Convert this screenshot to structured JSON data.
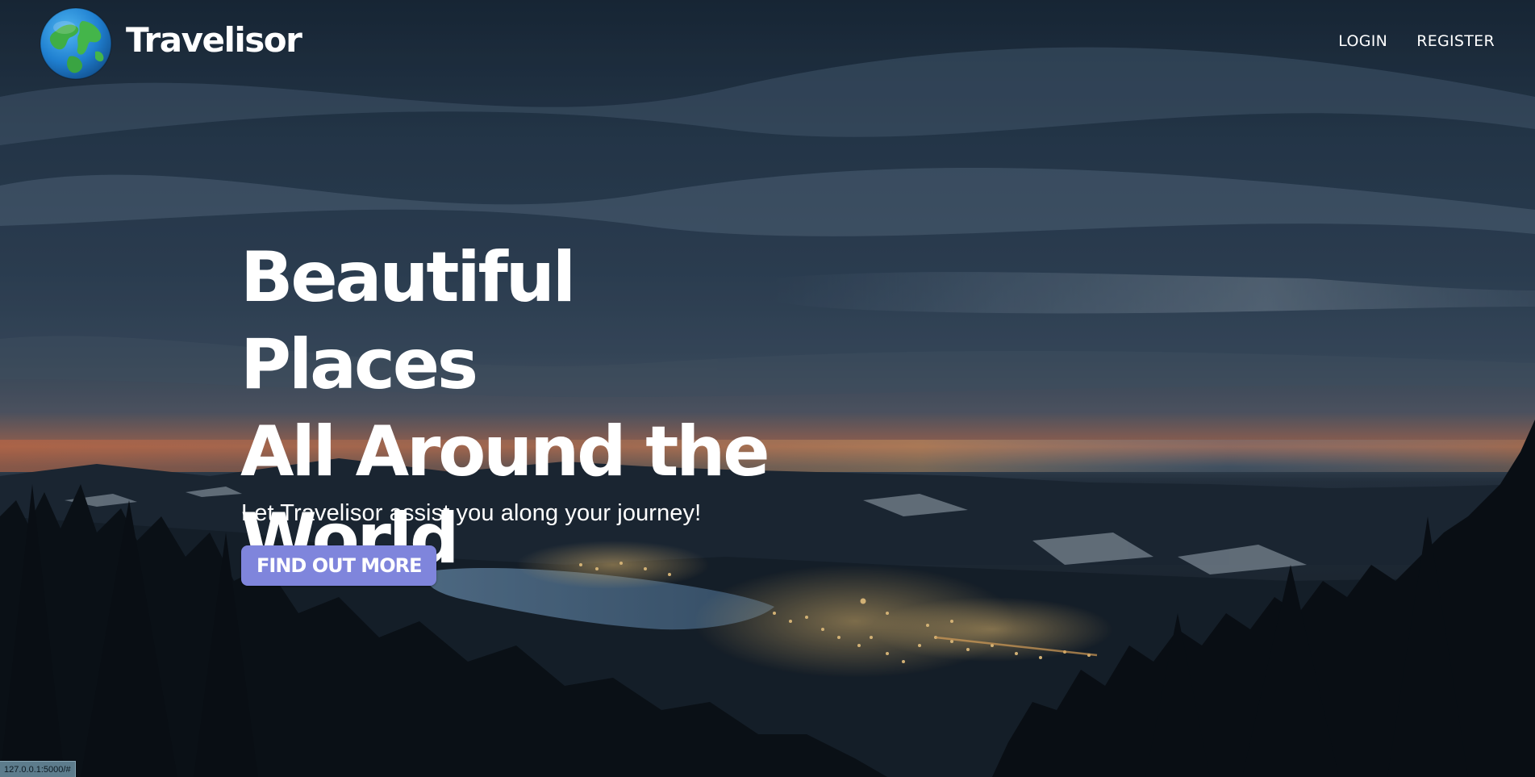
{
  "brand": {
    "name": "Travelisor",
    "logo_icon": "globe-icon"
  },
  "nav": {
    "links": [
      {
        "label": "LOGIN"
      },
      {
        "label": "REGISTER"
      }
    ]
  },
  "hero": {
    "headline_lines": [
      "Beautiful Places",
      "All Around the",
      "World"
    ],
    "tagline": "Let Travelisor assist you along your journey!",
    "cta_label": "FIND OUT MORE",
    "background": "night-landscape-lake-town-mountains"
  },
  "status_bar": {
    "url": "127.0.0.1:5000/#"
  },
  "colors": {
    "cta_background": "#7f85dc",
    "text": "#ffffff",
    "sky_dark": "#1b2c3f",
    "sunset_glow": "#e08a5a"
  }
}
